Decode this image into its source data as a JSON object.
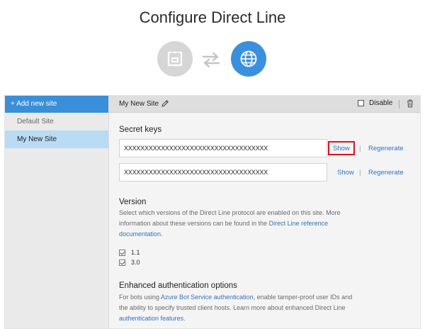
{
  "page": {
    "title": "Configure Direct Line"
  },
  "hero": {
    "left_icon": "bot-icon",
    "middle_icon": "swap-arrows-icon",
    "right_icon": "globe-icon"
  },
  "sidebar": {
    "add_label": "+ Add new site",
    "items": [
      {
        "label": "Default Site",
        "selected": false
      },
      {
        "label": "My New Site",
        "selected": true
      }
    ]
  },
  "header": {
    "site_name": "My New Site",
    "edit_icon": "pencil-icon",
    "disable_label": "Disable",
    "disable_checked": false,
    "delete_icon": "trash-icon"
  },
  "secret_keys": {
    "title": "Secret keys",
    "keys": [
      {
        "value": "XXXXXXXXXXXXXXXXXXXXXXXXXXXXXXXXXXX",
        "show_label": "Show",
        "regenerate_label": "Regenerate",
        "highlighted": true
      },
      {
        "value": "XXXXXXXXXXXXXXXXXXXXXXXXXXXXXXXXXXX",
        "show_label": "Show",
        "regenerate_label": "Regenerate",
        "highlighted": false
      }
    ]
  },
  "version": {
    "title": "Version",
    "desc_before": "Select which versions of the Direct Line protocol are enabled on this site. More information about these versions can be found in the ",
    "desc_link": "Direct Line reference documentation",
    "desc_after": ".",
    "options": [
      {
        "label": "1.1",
        "checked": true
      },
      {
        "label": "3.0",
        "checked": true
      }
    ]
  },
  "enhanced_auth": {
    "title": "Enhanced authentication options",
    "desc_part1": "For bots using ",
    "desc_link1": "Azure Bot Service authentication",
    "desc_part2": ", enable tamper-proof user IDs and the ability to specify trusted client hosts. Learn more about enhanced Direct Line ",
    "desc_link2": "authentication features",
    "desc_part3": "."
  },
  "colors": {
    "accent": "#3a8fd8",
    "selected_bg": "#b9dbf3",
    "link": "#2f74c0",
    "highlight": "#e0121a"
  }
}
